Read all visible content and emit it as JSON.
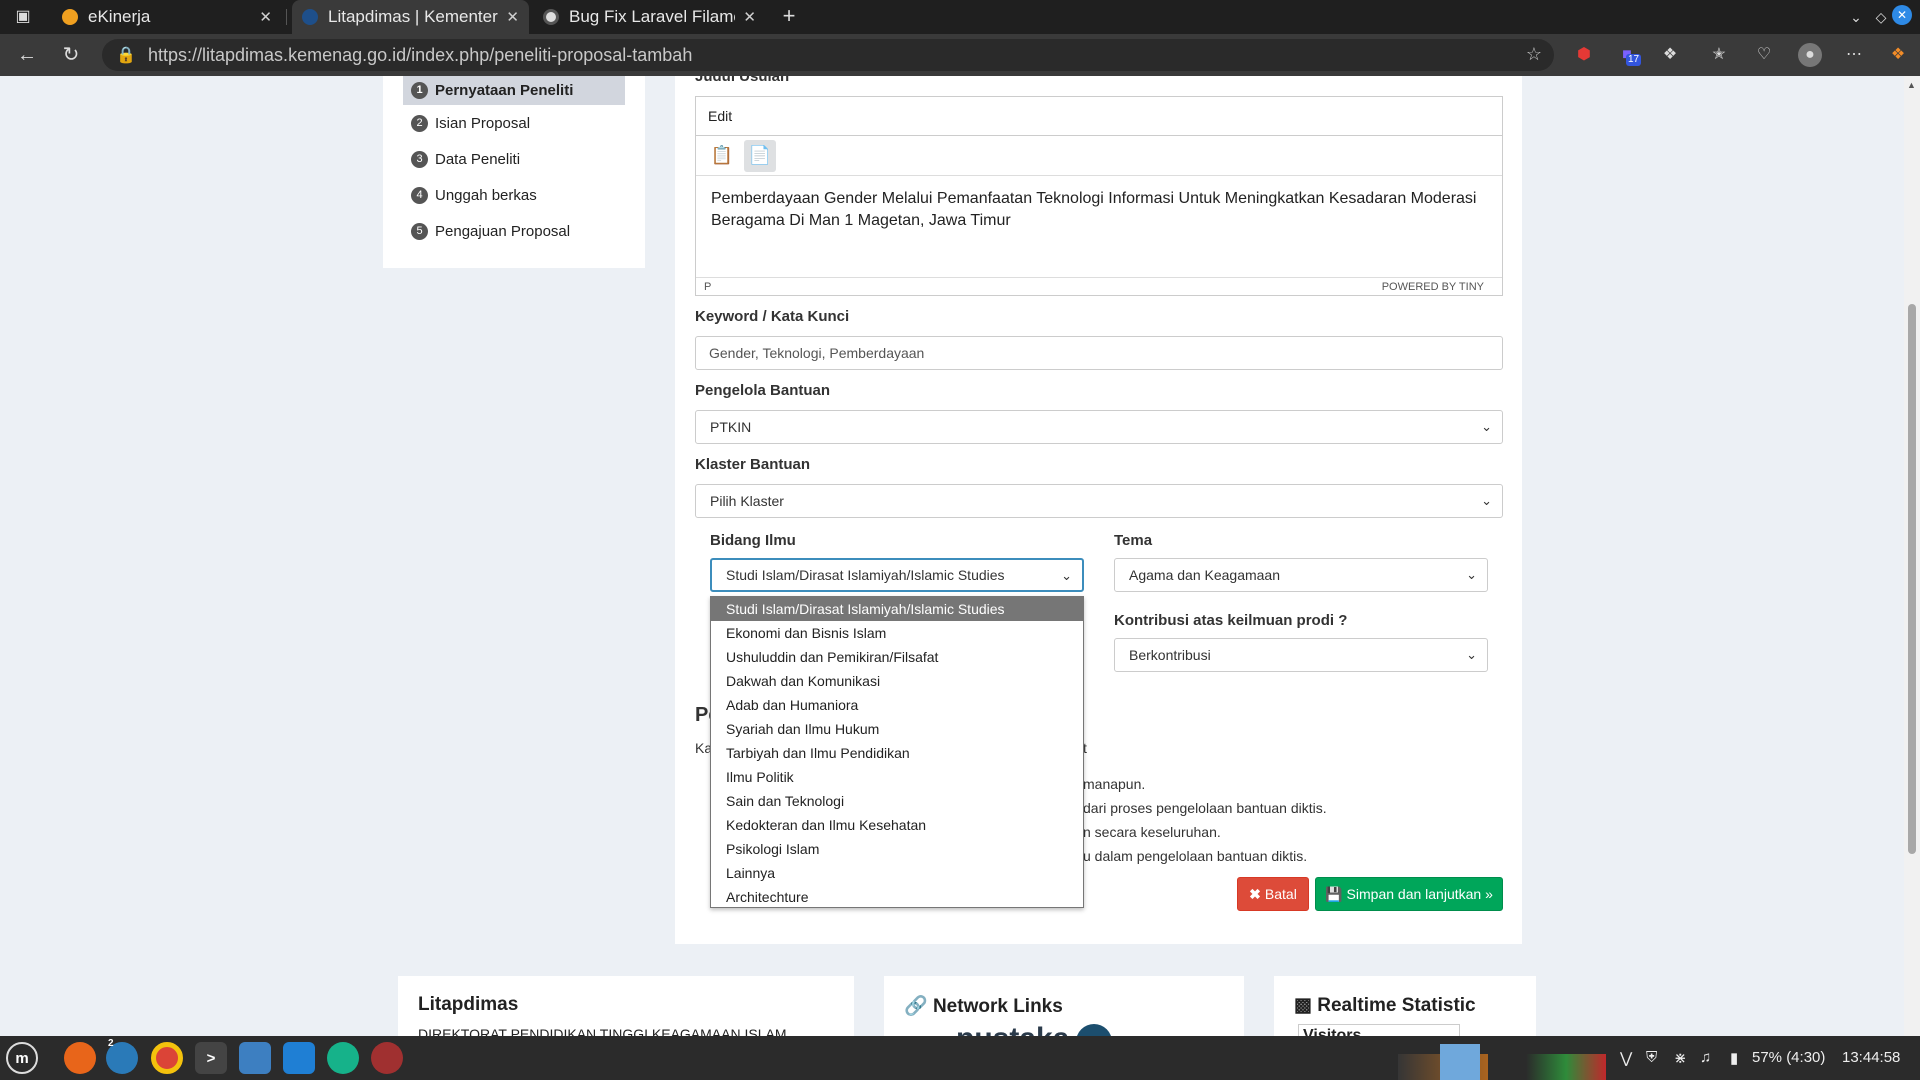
{
  "browser": {
    "tabs": [
      {
        "title": "eKinerja"
      },
      {
        "title": "Litapdimas | Kementerian"
      },
      {
        "title": "Bug Fix Laravel Filament"
      }
    ],
    "new_tab": "+",
    "url": "https://litapdimas.kemenag.go.id/index.php/peneliti-proposal-tambah",
    "ext_badge": "17"
  },
  "steps": [
    {
      "num": "1",
      "label": "Pernyataan Peneliti"
    },
    {
      "num": "2",
      "label": "Isian Proposal"
    },
    {
      "num": "3",
      "label": "Data Peneliti"
    },
    {
      "num": "4",
      "label": "Unggah berkas"
    },
    {
      "num": "5",
      "label": "Pengajuan Proposal"
    }
  ],
  "form": {
    "title_label": "Judul Usulan",
    "editor": {
      "menu": "Edit",
      "content": "Pemberdayaan Gender Melalui Pemanfaatan Teknologi Informasi Untuk Meningkatkan Kesadaran Moderasi Beragama Di Man 1 Magetan, Jawa Timur",
      "status_path": "P",
      "powered": "POWERED BY TINY"
    },
    "keyword_label": "Keyword / Kata Kunci",
    "keyword_value": "Gender, Teknologi, Pemberdayaan",
    "pengelola_label": "Pengelola Bantuan",
    "pengelola_value": "PTKIN",
    "klaster_label": "Klaster Bantuan",
    "klaster_value": "Pilih Klaster",
    "bidang_label": "Bidang Ilmu",
    "bidang_value": "Studi Islam/Dirasat Islamiyah/Islamic Studies",
    "tema_label": "Tema",
    "tema_value": "Agama dan Keagamaan",
    "kontribusi_label": "Kontribusi atas keilmuan prodi ?",
    "kontribusi_value": "Berkontribusi",
    "bidang_options": [
      "Studi Islam/Dirasat Islamiyah/Islamic Studies",
      "Ekonomi dan Bisnis Islam",
      "Ushuluddin dan Pemikiran/Filsafat",
      "Dakwah dan Komunikasi",
      "Adab dan Humaniora",
      "Syariah dan Ilmu Hukum",
      "Tarbiyah dan Ilmu Pendidikan",
      "Ilmu Politik",
      "Sain dan Teknologi",
      "Kedokteran dan Ilmu Kesehatan",
      "Psikologi Islam",
      "Lainnya",
      "Architechture"
    ],
    "agreement_head_fragment": "Pe",
    "agreement_sub_fragment": "Ka",
    "agreement_sub_tail": "t",
    "agreement_lines": [
      "manapun.",
      "dari proses pengelolaan bantuan diktis.",
      "n secara keseluruhan.",
      "u dalam pengelolaan bantuan diktis."
    ],
    "btn_batal": "Batal",
    "btn_simpan": "Simpan dan lanjutkan »"
  },
  "footer": {
    "litapdimas_title": "Litapdimas",
    "litapdimas_sub": "DIREKTORAT PENDIDIKAN TINGGI KEAGAMAAN ISLAM",
    "network_title": "Network Links",
    "network_logo_text": "pustaka",
    "stat_title": "Realtime Statistic",
    "stat_sub": "Visitors"
  },
  "taskbar": {
    "badge": "2",
    "battery": "57% (4:30)",
    "clock": "13:44:58"
  }
}
